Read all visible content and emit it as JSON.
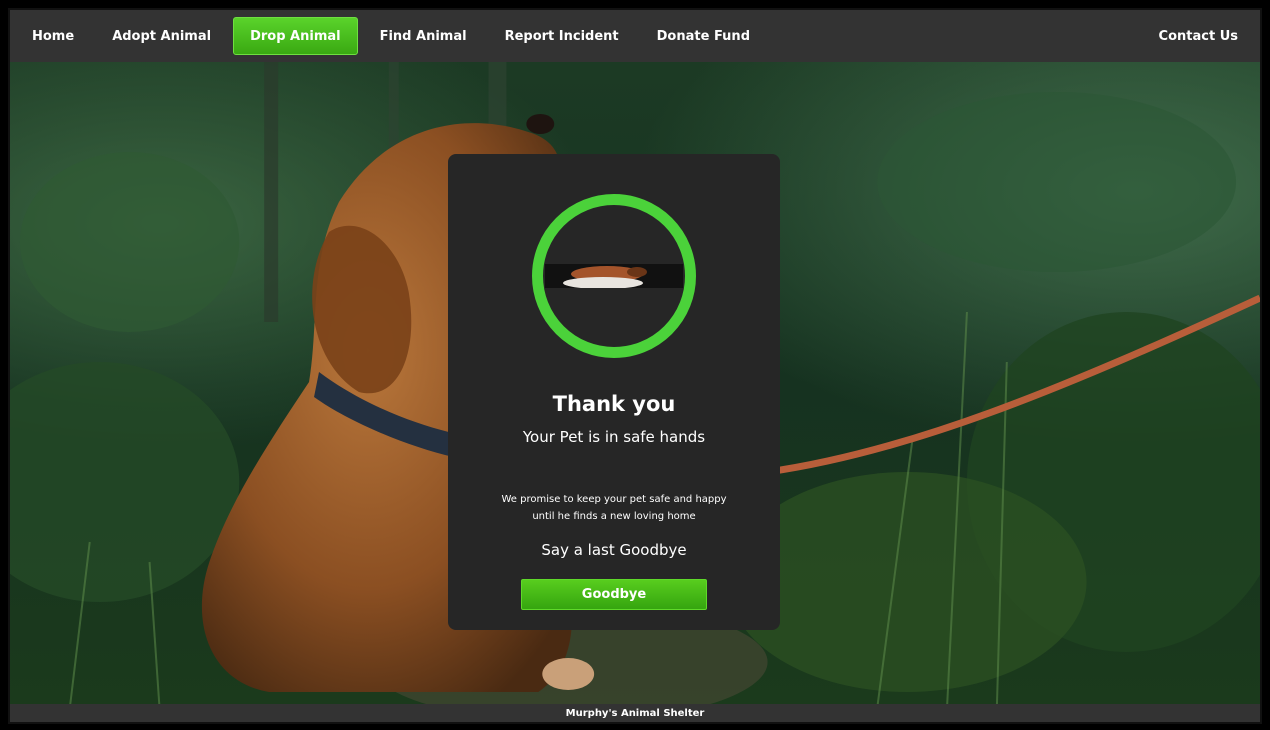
{
  "nav": {
    "items": [
      {
        "label": "Home",
        "active": false
      },
      {
        "label": "Adopt Animal",
        "active": false
      },
      {
        "label": "Drop Animal",
        "active": true
      },
      {
        "label": "Find Animal",
        "active": false
      },
      {
        "label": "Report Incident",
        "active": false
      },
      {
        "label": "Donate Fund",
        "active": false
      }
    ],
    "contact_label": "Contact Us"
  },
  "card": {
    "image_icon": "pet-photo",
    "title": "Thank you",
    "subtitle": "Your Pet is in safe hands",
    "promise_line1": "We promise to keep your pet safe and happy",
    "promise_line2": "until he finds a new loving home",
    "goodbye_text": "Say a last Goodbye",
    "goodbye_button": "Goodbye"
  },
  "footer": {
    "text": "Murphy's Animal Shelter"
  },
  "colors": {
    "accent": "#4bd23a",
    "nav_bg": "#333333",
    "card_bg": "#262626",
    "button": "#45b817"
  }
}
